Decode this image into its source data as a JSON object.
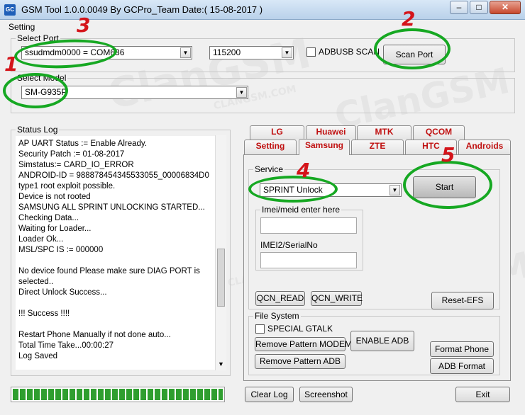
{
  "window": {
    "title": "GSM Tool 1.0.0.0049 By GCPro_Team  Date:( 15-08-2017 )",
    "icon_text": "GC",
    "minimize_glyph": "–",
    "maximize_glyph": "□",
    "close_glyph": "✕"
  },
  "menu": {
    "setting": "Setting"
  },
  "select_port": {
    "label": "Select Port",
    "port": "ssudmdm0000 = COM636",
    "baud": "115200",
    "adbusb_scan_label": "ADBUSB SCAN",
    "adbusb_scan_checked": false,
    "scan_button": "Scan Port"
  },
  "select_model": {
    "label": "Select Model",
    "model": "SM-G935P"
  },
  "status_log": {
    "label": "Status Log",
    "lines": [
      "AP UART Status := Enable Already.",
      "Security Patch := 01-08-2017",
      "Simstatus:= CARD_IO_ERROR",
      "ANDROID-ID = 988878454345533055_00006834D0",
      "type1 root exploit possible.",
      "Device is not rooted",
      "SAMSUNG ALL SPRINT UNLOCKING STARTED...",
      "Checking Data...",
      "Waiting for Loader...",
      "Loader Ok...",
      "MSL/SPC IS := 000000",
      "",
      "No device found Please make sure DIAG PORT is",
      "selected..",
      "Direct Unlock Success...",
      "",
      "!!! Success !!!!",
      "",
      "Restart Phone Manually if not done auto...",
      "Total Time Take...00:00:27",
      "Log Saved"
    ],
    "progress": 1.0
  },
  "tabs": {
    "top_row": [
      "LG",
      "Huawei",
      "MTK",
      "QCOM"
    ],
    "bottom_row": [
      "Setting",
      "Samsung",
      "ZTE",
      "HTC",
      "Androids"
    ],
    "active": "Samsung"
  },
  "service": {
    "label": "Service",
    "selected": "SPRINT Unlock",
    "start_button": "Start",
    "imei_group_label": "Imei/meid enter here",
    "imei2_label": "IMEI2/SerialNo",
    "imei_value": "",
    "imei2_value": "",
    "qcn_read": "QCN_READ",
    "qcn_write": "QCN_WRITE",
    "reset_efs": "Reset-EFS"
  },
  "file_system": {
    "label": "File System",
    "special_gtalk_label": "SPECIAL GTALK",
    "special_gtalk_checked": false,
    "remove_pattern_modem": "Remove Pattern MODEM",
    "remove_pattern_adb": "Remove Pattern ADB",
    "enable_adb": "ENABLE ADB",
    "format_phone": "Format Phone",
    "adb_format": "ADB Format"
  },
  "bottom_buttons": {
    "clear_log": "Clear Log",
    "screenshot": "Screenshot",
    "exit": "Exit"
  },
  "annotations": {
    "marks": [
      "1",
      "2",
      "3",
      "4",
      "5"
    ],
    "mark_color": "#d4141a",
    "ring_color": "#16a822"
  },
  "watermark": {
    "big": "ClanGSM",
    "small": "CLANGSM.COM"
  },
  "colors": {
    "tab_text": "#c01010",
    "progress_green": "#2f9e2f"
  }
}
